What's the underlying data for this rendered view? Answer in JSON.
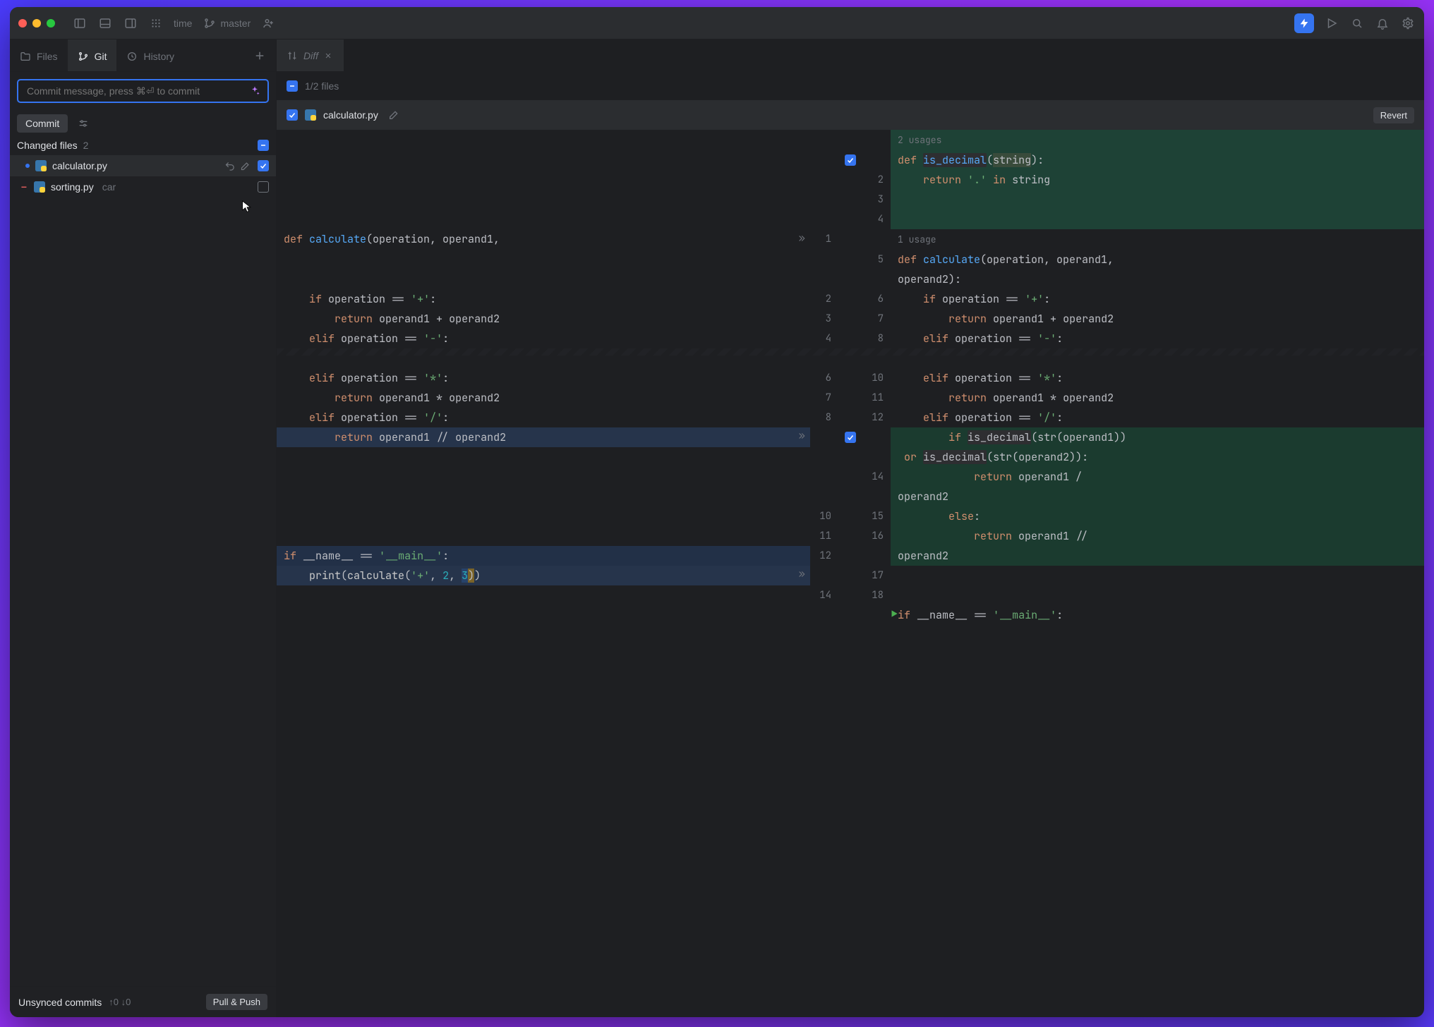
{
  "titlebar": {
    "project_name": "time",
    "branch": "master"
  },
  "side_tabs": {
    "files": "Files",
    "git": "Git",
    "history": "History"
  },
  "commit": {
    "placeholder": "Commit message, press ⌘⏎ to commit",
    "button": "Commit"
  },
  "changed": {
    "label": "Changed files",
    "count": "2",
    "files": [
      {
        "name": "calculator.py",
        "status": "modified",
        "checked": true,
        "selected": true
      },
      {
        "name": "sorting.py",
        "dir": "car",
        "status": "deleted",
        "checked": false
      }
    ]
  },
  "unsynced": {
    "label": "Unsynced commits",
    "up": "0",
    "down": "0",
    "pull_push_button": "Pull & Push"
  },
  "editor": {
    "tab_label": "Diff",
    "counter": "1/2 files",
    "revert_button": "Revert",
    "file_name": "calculator.py",
    "hints": {
      "two_usages": "2 usages",
      "one_usage": "1 usage"
    }
  },
  "diff_left": [
    {
      "ln": "",
      "text": "",
      "cls": ""
    },
    {
      "ln": "",
      "text": "",
      "cls": ""
    },
    {
      "ln": "",
      "text": "",
      "cls": ""
    },
    {
      "ln": "",
      "text": "",
      "cls": ""
    },
    {
      "ln": "",
      "text": "",
      "cls": ""
    },
    {
      "ln": "1",
      "html": "<span class='kw'>def</span> <span class='fnname'>calculate</span>(operation, operand1,",
      "more": true
    },
    {
      "ln": "",
      "text": ""
    },
    {
      "ln": "",
      "text": ""
    },
    {
      "ln": "2",
      "html": "    <span class='kw'>if</span> operation <span class='op'>==</span> <span class='st'>'+'</span>:"
    },
    {
      "ln": "3",
      "html": "        <span class='kw'>return</span> operand1 <span class='op'>+</span> operand2"
    },
    {
      "ln": "4",
      "html": "    <span class='kw'>elif</span> operation <span class='op'>==</span> <span class='st'>'-'</span>:"
    },
    {
      "wavy": true
    },
    {
      "ln": "6",
      "html": "    <span class='kw'>elif</span> operation <span class='op'>==</span> <span class='st'>'*'</span>:"
    },
    {
      "ln": "7",
      "html": "        <span class='kw'>return</span> operand1 <span class='op'>*</span> operand2"
    },
    {
      "ln": "8",
      "html": "    <span class='kw'>elif</span> operation <span class='op'>==</span> <span class='st'>'/'</span>:"
    },
    {
      "ln": "",
      "html": "        <span class='kw'>return</span> operand1 <span class='op'>//</span> operand2",
      "cls": "bg-del",
      "more": true
    },
    {
      "ln": "",
      "text": "",
      "cls": ""
    },
    {
      "ln": "",
      "text": "",
      "cls": ""
    },
    {
      "ln": "",
      "text": "",
      "cls": ""
    },
    {
      "ln": "10",
      "html": ""
    },
    {
      "ln": "11",
      "html": ""
    },
    {
      "ln": "12",
      "html": "<span class='kw'>if</span> __name__ <span class='op'>==</span> <span class='st'>'__main__'</span>:",
      "cls": "bg-mod"
    },
    {
      "ln": "",
      "html": "    <span class='fn'>print</span>(<span class='fn'>calculate</span>(<span class='st'>'+'</span>, <span class='nu'>2</span>, <span class='nu bg-inner'>3</span><span class='hl-paren'>)</span>)",
      "cls": "bg-del",
      "more": true
    },
    {
      "ln": "14",
      "html": ""
    }
  ],
  "diff_right": [
    {
      "ln": "",
      "html": "<span class='hint'>2 usages</span>",
      "cls": "bg-add-sel"
    },
    {
      "ln": "",
      "html": "<span class='kw'>def</span> <span class='fnname'><span class='hl-box'>is_decimal</span></span>(<span class='hl-param'>string</span>):",
      "cls": "bg-add-sel",
      "midchk": true
    },
    {
      "ln": "2",
      "html": "    <span class='kw'>return</span> <span class='st'>'.'</span> <span class='kw'>in</span> string",
      "cls": "bg-add-sel"
    },
    {
      "ln": "3",
      "html": "",
      "cls": "bg-add-sel"
    },
    {
      "ln": "4",
      "html": "",
      "cls": "bg-add-sel"
    },
    {
      "ln": "",
      "html": "<span class='hint'>1 usage</span>"
    },
    {
      "ln": "5",
      "html": "<span class='kw'>def</span> <span class='fnname'>calculate</span>(operation, operand1,"
    },
    {
      "ln": "",
      "html": "operand2):"
    },
    {
      "ln": "6",
      "html": "    <span class='kw'>if</span> operation <span class='op'>==</span> <span class='st'>'+'</span>:"
    },
    {
      "ln": "7",
      "html": "        <span class='kw'>return</span> operand1 <span class='op'>+</span> operand2"
    },
    {
      "ln": "8",
      "html": "    <span class='kw'>elif</span> operation <span class='op'>==</span> <span class='st'>'-'</span>:"
    },
    {
      "wavy": true
    },
    {
      "ln": "10",
      "html": "    <span class='kw'>elif</span> operation <span class='op'>==</span> <span class='st'>'*'</span>:"
    },
    {
      "ln": "11",
      "html": "        <span class='kw'>return</span> operand1 <span class='op'>*</span> operand2"
    },
    {
      "ln": "12",
      "html": "    <span class='kw'>elif</span> operation <span class='op'>==</span> <span class='st'>'/'</span>:"
    },
    {
      "ln": "",
      "html": "        <span class='kw'>if</span> <span class='hl-box'>is_decimal</span>(str(operand1))",
      "cls": "bg-add",
      "midchk": true
    },
    {
      "ln": "",
      "html": " <span class='kw'>or</span> <span class='hl-box'>is_decimal</span>(str(operand2)):",
      "cls": "bg-add"
    },
    {
      "ln": "14",
      "html": "            <span class='kw'>return</span> operand1 /",
      "cls": "bg-add"
    },
    {
      "ln": "",
      "html": "operand2",
      "cls": "bg-add"
    },
    {
      "ln": "15",
      "html": "        <span class='kw'>else</span>:",
      "cls": "bg-add"
    },
    {
      "ln": "16",
      "html": "            <span class='kw'>return</span> operand1 //",
      "cls": "bg-add"
    },
    {
      "ln": "",
      "html": "operand2",
      "cls": "bg-add"
    },
    {
      "ln": "17",
      "html": ""
    },
    {
      "ln": "18",
      "html": ""
    },
    {
      "ln": "",
      "html": "<span class='kw'>if</span> __name__ <span class='op'>==</span> <span class='st'>'__main__'</span>:",
      "play": true
    }
  ]
}
